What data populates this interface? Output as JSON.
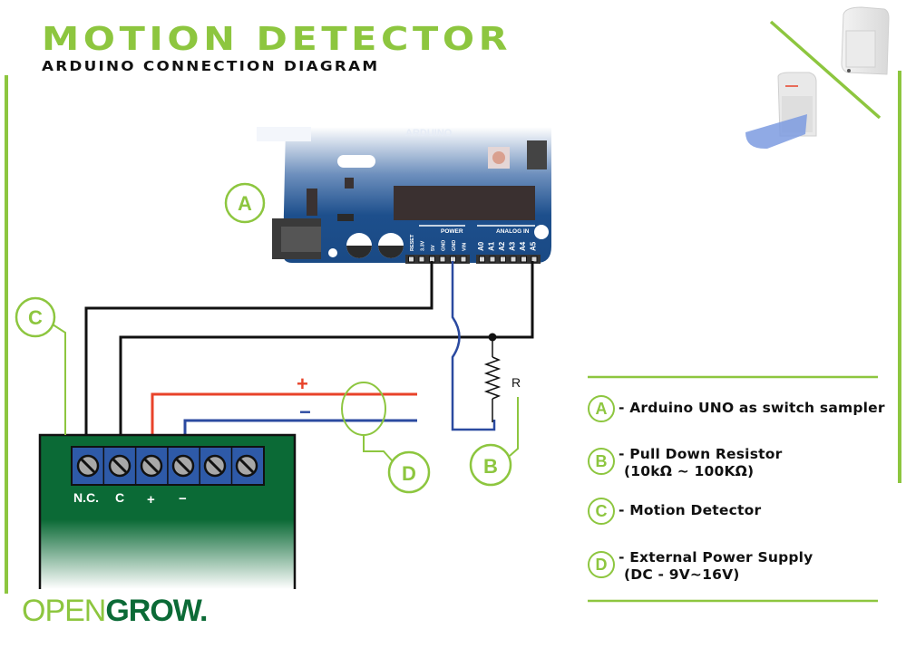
{
  "header": {
    "title": "MOTION DETECTOR",
    "subtitle": "ARDUINO CONNECTION DIAGRAM"
  },
  "arduino": {
    "brand": "ARDUINO",
    "power_header_label": "POWER",
    "analog_header_label": "ANALOG IN",
    "power_pins": [
      "RESET",
      "3.3V",
      "5V",
      "GND",
      "GND",
      "VIN"
    ],
    "analog_pins": [
      "A0",
      "A1",
      "A2",
      "A3",
      "A4",
      "A5"
    ]
  },
  "callouts": {
    "a": "A",
    "b": "B",
    "c": "C",
    "d": "D"
  },
  "resistor_label": "R",
  "power_supply": {
    "plus_label": "+",
    "minus_label": "−"
  },
  "detector": {
    "terminal_labels": [
      "N.C.",
      "C",
      "+",
      "−"
    ]
  },
  "legend": {
    "items": [
      {
        "badge": "A",
        "text": "- Arduino UNO as switch sampler",
        "sub": ""
      },
      {
        "badge": "B",
        "text": "- Pull Down Resistor",
        "sub": "(10kΩ ~ 100KΩ)"
      },
      {
        "badge": "C",
        "text": "- Motion Detector",
        "sub": ""
      },
      {
        "badge": "D",
        "text": "- External Power Supply",
        "sub": "(DC  -  9V~16V)"
      }
    ]
  },
  "logo": {
    "open": "OPEN",
    "grow": "GROW."
  },
  "colors": {
    "accent_green": "#8dc63f",
    "board_blue": "#1d4f8c",
    "wire_black": "#111111",
    "wire_red": "#e8432a",
    "wire_blue": "#2b4aa0",
    "pcb_green": "#0b6a36",
    "terminal_blue": "#2e5aa8"
  }
}
